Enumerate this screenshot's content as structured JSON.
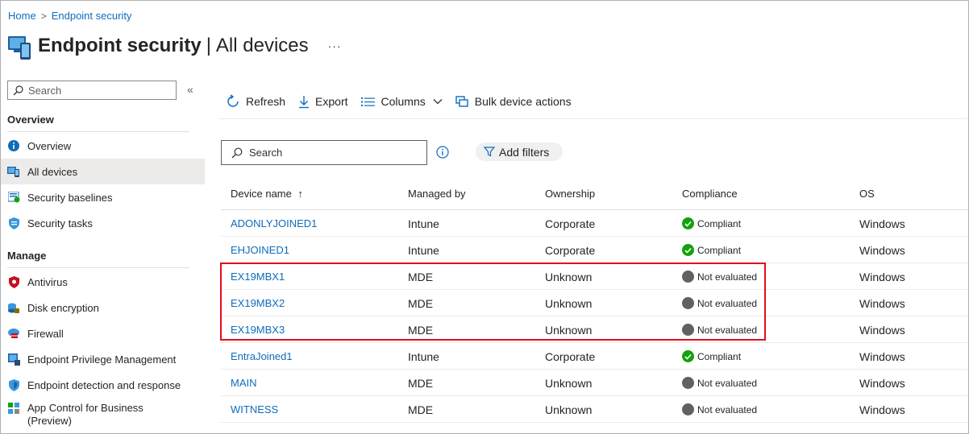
{
  "breadcrumb": {
    "home": "Home",
    "current": "Endpoint security"
  },
  "page": {
    "title": "Endpoint security",
    "separator": "|",
    "subtitle": "All devices",
    "more": "···"
  },
  "sidebar": {
    "search_placeholder": "Search",
    "collapse": "«",
    "overview_label": "Overview",
    "manage_label": "Manage",
    "overview_items": [
      {
        "label": "Overview",
        "icon": "info-icon"
      },
      {
        "label": "All devices",
        "icon": "devices-icon",
        "active": true
      },
      {
        "label": "Security baselines",
        "icon": "baseline-icon"
      },
      {
        "label": "Security tasks",
        "icon": "task-shield-icon"
      }
    ],
    "manage_items": [
      {
        "label": "Antivirus",
        "icon": "antivirus-shield-icon"
      },
      {
        "label": "Disk encryption",
        "icon": "disk-encryption-icon"
      },
      {
        "label": "Firewall",
        "icon": "firewall-icon"
      },
      {
        "label": "Endpoint Privilege Management",
        "icon": "privilege-icon"
      },
      {
        "label": "Endpoint detection and response",
        "icon": "edr-shield-icon"
      },
      {
        "label": "App Control for Business",
        "label2": "(Preview)",
        "icon": "app-control-icon"
      }
    ]
  },
  "toolbar": {
    "refresh": "Refresh",
    "export": "Export",
    "columns": "Columns",
    "bulk": "Bulk device actions"
  },
  "filters": {
    "search_placeholder": "Search",
    "add_filters": "Add filters"
  },
  "table": {
    "columns": [
      "Device name",
      "Managed by",
      "Ownership",
      "Compliance",
      "OS"
    ],
    "sort_indicator": "↑",
    "rows": [
      {
        "name": "ADONLYJOINED1",
        "managed": "Intune",
        "ownership": "Corporate",
        "compliance": "Compliant",
        "status": "compliant",
        "os": "Windows"
      },
      {
        "name": "EHJOINED1",
        "managed": "Intune",
        "ownership": "Corporate",
        "compliance": "Compliant",
        "status": "compliant",
        "os": "Windows"
      },
      {
        "name": "EX19MBX1",
        "managed": "MDE",
        "ownership": "Unknown",
        "compliance": "Not evaluated",
        "status": "not-evaluated",
        "os": "Windows"
      },
      {
        "name": "EX19MBX2",
        "managed": "MDE",
        "ownership": "Unknown",
        "compliance": "Not evaluated",
        "status": "not-evaluated",
        "os": "Windows"
      },
      {
        "name": "EX19MBX3",
        "managed": "MDE",
        "ownership": "Unknown",
        "compliance": "Not evaluated",
        "status": "not-evaluated",
        "os": "Windows"
      },
      {
        "name": "EntraJoined1",
        "managed": "Intune",
        "ownership": "Corporate",
        "compliance": "Compliant",
        "status": "compliant",
        "os": "Windows"
      },
      {
        "name": "MAIN",
        "managed": "MDE",
        "ownership": "Unknown",
        "compliance": "Not evaluated",
        "status": "not-evaluated",
        "os": "Windows"
      },
      {
        "name": "WITNESS",
        "managed": "MDE",
        "ownership": "Unknown",
        "compliance": "Not evaluated",
        "status": "not-evaluated",
        "os": "Windows"
      }
    ]
  },
  "colors": {
    "link": "#0f6cbd",
    "compliant": "#13a10e",
    "not_evaluated": "#616161",
    "highlight": "#e0101a"
  }
}
